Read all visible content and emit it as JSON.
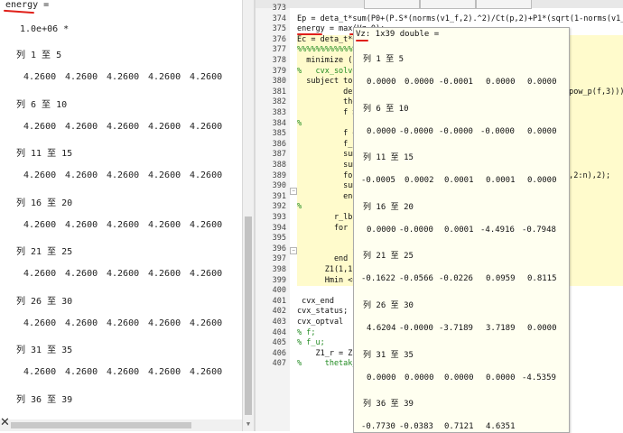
{
  "left_panel": {
    "var_label": "energy =",
    "scale": "1.0e+06 *",
    "groups": [
      {
        "header": "列 1 至 5",
        "values": [
          "4.2600",
          "4.2600",
          "4.2600",
          "4.2600",
          "4.2600"
        ]
      },
      {
        "header": "列 6 至 10",
        "values": [
          "4.2600",
          "4.2600",
          "4.2600",
          "4.2600",
          "4.2600"
        ]
      },
      {
        "header": "列 11 至 15",
        "values": [
          "4.2600",
          "4.2600",
          "4.2600",
          "4.2600",
          "4.2600"
        ]
      },
      {
        "header": "列 16 至 20",
        "values": [
          "4.2600",
          "4.2600",
          "4.2600",
          "4.2600",
          "4.2600"
        ]
      },
      {
        "header": "列 21 至 25",
        "values": [
          "4.2600",
          "4.2600",
          "4.2600",
          "4.2600",
          "4.2600"
        ]
      },
      {
        "header": "列 26 至 30",
        "values": [
          "4.2600",
          "4.2600",
          "4.2600",
          "4.2600",
          "4.2600"
        ]
      },
      {
        "header": "列 31 至 35",
        "values": [
          "4.2600",
          "4.2600",
          "4.2600",
          "4.2600",
          "4.2600"
        ]
      },
      {
        "header": "列 36 至 39",
        "values": []
      }
    ],
    "close_glyph": "✕"
  },
  "editor": {
    "top_fragment": "Ep = deta_t*sum(Pd+(P.S*(norms(v1_f,2).^2)/Ct(p,2)+P1*(sqrt(1-norms(v1_f,2).^4)/(Rabs",
    "lines": [
      {
        "num": "373",
        "text": "",
        "kind": "code"
      },
      {
        "num": "374",
        "text": "Ep = deta_t*sum(P0+(P.S*(norms(v1_f,2).^2)/Ct(p,2)+P1*(sqrt(1-norms(v1_f,2).^4)",
        "kind": "code"
      },
      {
        "num": "375",
        "text": "energy = max(Vz,0);",
        "kind": "code"
      },
      {
        "num": "376",
        "text": "Ec = deta_t*G*",
        "kind": "code"
      },
      {
        "num": "377",
        "text": "%%%%%%%%%%%%%%",
        "kind": "comment"
      },
      {
        "num": "378",
        "text": "  minimize ( m",
        "kind": "code"
      },
      {
        "num": "379",
        "text": "%   cvx_solver",
        "kind": "comment"
      },
      {
        "num": "380",
        "text": "  subject to",
        "kind": "code"
      },
      {
        "num": "381",
        "text": "          deta",
        "kind": "code"
      },
      {
        "num": "382",
        "text": "          the",
        "kind": "code"
      },
      {
        "num": "383",
        "text": "          f >",
        "kind": "code"
      },
      {
        "num": "384",
        "text": "%           f",
        "kind": "comment"
      },
      {
        "num": "385",
        "text": "          f <",
        "kind": "code"
      },
      {
        "num": "386",
        "text": "          f_u",
        "kind": "code"
      },
      {
        "num": "387",
        "text": "          sum",
        "kind": "code"
      },
      {
        "num": "388",
        "text": "          sum",
        "kind": "code"
      },
      {
        "num": "389",
        "text": "          for",
        "kind": "code"
      },
      {
        "num": "390",
        "text": "          sum",
        "kind": "code"
      },
      {
        "num": "391",
        "text": "          end",
        "kind": "code"
      },
      {
        "num": "392",
        "text": "%           r",
        "kind": "comment"
      },
      {
        "num": "393",
        "text": "        r_lb",
        "kind": "code"
      },
      {
        "num": "394",
        "text": "        for i",
        "kind": "code"
      },
      {
        "num": "395",
        "text": "            Z1",
        "kind": "code"
      },
      {
        "num": "396",
        "text": "            ab",
        "kind": "code"
      },
      {
        "num": "397",
        "text": "        end",
        "kind": "code"
      },
      {
        "num": "398",
        "text": "      Z1(1,1)",
        "kind": "code"
      },
      {
        "num": "399",
        "text": "      Hmin <=",
        "kind": "code"
      },
      {
        "num": "400",
        "text": "",
        "kind": "code"
      },
      {
        "num": "401",
        "text": " cvx_end",
        "kind": "code"
      },
      {
        "num": "402",
        "text": "cvx_status;",
        "kind": "code"
      },
      {
        "num": "403",
        "text": "cvx_optval",
        "kind": "code"
      },
      {
        "num": "404",
        "text": "% f;",
        "kind": "comment"
      },
      {
        "num": "405",
        "text": "% f_u;",
        "kind": "comment"
      },
      {
        "num": "406",
        "text": "    Z1_r = Z1;",
        "kind": "code"
      },
      {
        "num": "407",
        "text": "%     thetak_r",
        "kind": "comment"
      }
    ],
    "overflow_right": [
      {
        "line": "381",
        "text": "*pow_p(f,3)))<="
      },
      {
        "line": "389",
        "text": ":,2:n),2);"
      }
    ]
  },
  "tooltip": {
    "title": "Vz: 1x39 double =",
    "groups": [
      {
        "header": "列 1 至 5",
        "values": [
          "0.0000",
          "0.0000",
          "-0.0001",
          "0.0000",
          "0.0000"
        ]
      },
      {
        "header": "列 6 至 10",
        "values": [
          "0.0000",
          "-0.0000",
          "-0.0000",
          "-0.0000",
          "0.0000"
        ]
      },
      {
        "header": "列 11 至 15",
        "values": [
          "-0.0005",
          "0.0002",
          "0.0001",
          "0.0001",
          "0.0000"
        ]
      },
      {
        "header": "列 16 至 20",
        "values": [
          "0.0000",
          "-0.0000",
          "0.0001",
          "-4.4916",
          "-0.7948"
        ]
      },
      {
        "header": "列 21 至 25",
        "values": [
          "-0.1622",
          "-0.0566",
          "-0.0226",
          "0.0959",
          "0.8115"
        ]
      },
      {
        "header": "列 26 至 30",
        "values": [
          "4.6204",
          "-0.0000",
          "-3.7189",
          "3.7189",
          "0.0000"
        ]
      },
      {
        "header": "列 31 至 35",
        "values": [
          "0.0000",
          "0.0000",
          "0.0000",
          "0.0000",
          "-4.5359"
        ]
      },
      {
        "header": "列 36 至 39",
        "values": [
          "-0.7730",
          "-0.0383",
          "0.7121",
          "4.6351"
        ]
      }
    ]
  },
  "colors": {
    "annotation_red": "#e0201a",
    "comment_green": "#228b22",
    "keyword_blue": "#1a1aff",
    "tooltip_bg": "#fffff0"
  }
}
